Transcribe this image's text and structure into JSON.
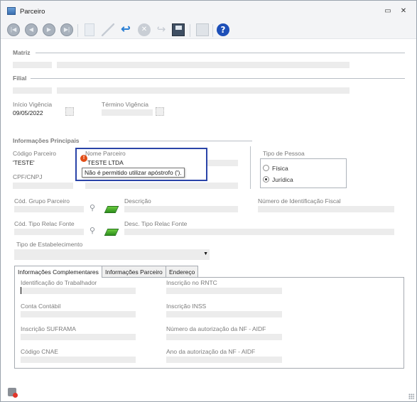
{
  "window": {
    "title": "Parceiro",
    "minimize_glyph": "▭",
    "close_glyph": "✕"
  },
  "toolbar": {
    "icons": [
      "first-record-icon",
      "previous-record-icon",
      "next-record-icon",
      "last-record-icon",
      "new-icon",
      "edit-icon",
      "undo-icon",
      "cancel-icon",
      "redo-icon",
      "save-icon",
      "lock-icon",
      "help-icon"
    ],
    "help_glyph": "?"
  },
  "sections": {
    "matriz": "Matriz",
    "filial": "Filial",
    "principais": "Informações Principais"
  },
  "vigencia": {
    "inicio_label": "Início Vigência",
    "inicio_value": "09/05/2022",
    "termino_label": "Término Vigência",
    "termino_value": ""
  },
  "principais": {
    "codigo_label": "Código Parceiro",
    "codigo_value": "'TESTE'",
    "nome_label": "Nome Parceiro",
    "nome_value": "TESTE LTDA",
    "cpf_label": "CPF/CNPJ",
    "tooltip": "Não é permitido utilizar apóstrofo (').",
    "tipo_pessoa_label": "Tipo de Pessoa",
    "fisica_label": "Física",
    "juridica_label": "Jurídica",
    "selected_tipo_pessoa": "Jurídica",
    "grupo_label": "Cód. Grupo Parceiro",
    "descricao_label": "Descrição",
    "nif_label": "Número de Identificação Fiscal",
    "relac_label": "Cód. Tipo Relac Fonte",
    "desc_relac_label": "Desc. Tipo Relac Fonte",
    "estabelecimento_label": "Tipo de Estabelecimento",
    "estabelecimento_value": ""
  },
  "tabs": [
    {
      "label": "Informações Complementares",
      "active": true
    },
    {
      "label": "Informações Parceiro",
      "active": false
    },
    {
      "label": "Endereço",
      "active": false
    }
  ],
  "complementares": {
    "trabalhador_label": "Identificação do Trabalhador",
    "rntc_label": "Inscrição no RNTC",
    "conta_label": "Conta Contábil",
    "inss_label": "Inscrição INSS",
    "suframa_label": "Inscrição SUFRAMA",
    "aidf_label": "Número da autorização da NF - AIDF",
    "cnae_label": "Código CNAE",
    "ano_aidf_label": "Ano da autorização da NF - AIDF"
  },
  "colors": {
    "focus_border": "#2a44a8",
    "error_icon": "#e24d17",
    "help_icon": "#1d4fb8"
  }
}
